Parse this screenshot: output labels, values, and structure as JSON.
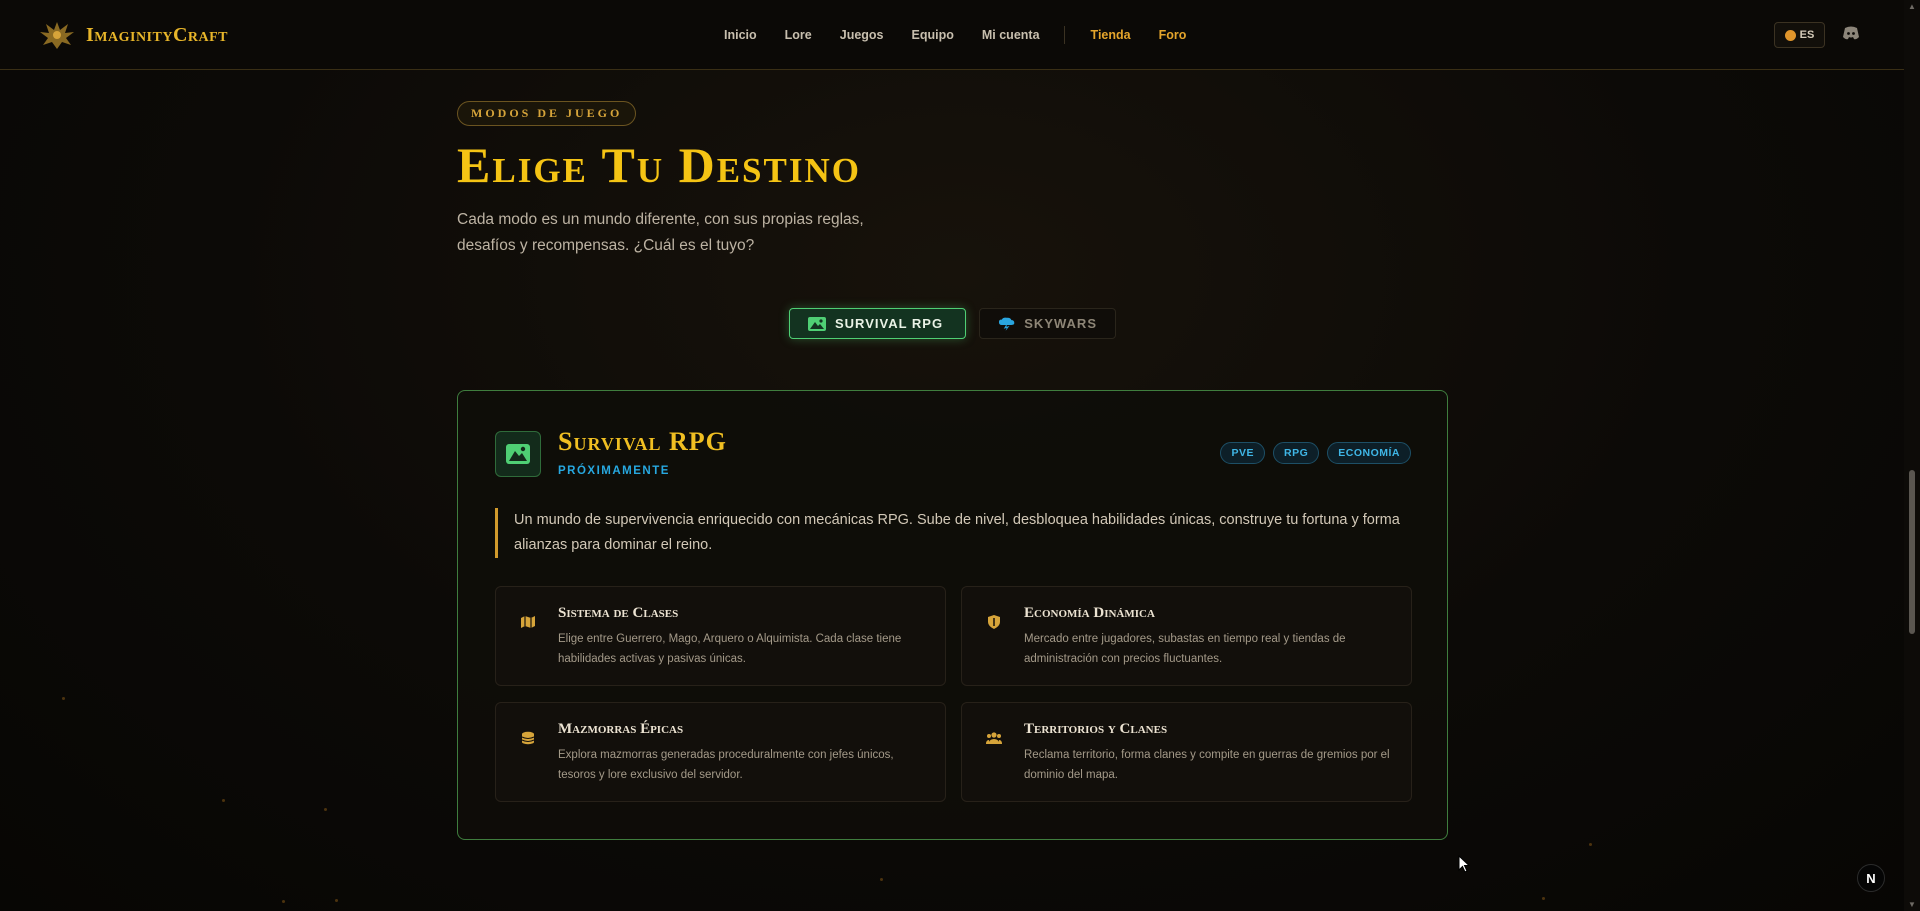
{
  "header": {
    "brand": "ImaginityCraft",
    "nav": [
      "Inicio",
      "Lore",
      "Juegos",
      "Equipo",
      "Mi cuenta"
    ],
    "nav_highlight": [
      "Tienda",
      "Foro"
    ],
    "language": "ES",
    "discord_icon": "discord-icon"
  },
  "section": {
    "eyebrow": "MODOS DE JUEGO",
    "title": "Elige Tu Destino",
    "subtitle": "Cada modo es un mundo diferente, con sus propias reglas, desafíos y recompensas. ¿Cuál es el tuyo?"
  },
  "tabs": [
    {
      "label": "SURVIVAL RPG",
      "icon": "mountain-icon",
      "active": true
    },
    {
      "label": "SKYWARS",
      "icon": "cloud-lightning-icon",
      "active": false
    }
  ],
  "card": {
    "title": "Survival RPG",
    "status": "PRÓXIMAMENTE",
    "tags": [
      "PVE",
      "RPG",
      "ECONOMÍA"
    ],
    "description": "Un mundo de supervivencia enriquecido con mecánicas RPG. Sube de nivel, desbloquea habilidades únicas, construye tu fortuna y forma alianzas para dominar el reino.",
    "features": [
      {
        "title": "Sistema de Clases",
        "desc": "Elige entre Guerrero, Mago, Arquero o Alquimista. Cada clase tiene habilidades activas y pasivas únicas.",
        "icon": "map-icon"
      },
      {
        "title": "Economía Dinámica",
        "desc": "Mercado entre jugadores, subastas en tiempo real y tiendas de administración con precios fluctuantes.",
        "icon": "shield-icon"
      },
      {
        "title": "Mazmorras Épicas",
        "desc": "Explora mazmorras generadas proceduralmente con jefes únicos, tesoros y lore exclusivo del servidor.",
        "icon": "coins-icon"
      },
      {
        "title": "Territorios y Clanes",
        "desc": "Reclama territorio, forma clanes y compite en guerras de gremios por el dominio del mapa.",
        "icon": "users-icon"
      }
    ]
  },
  "badge": "N",
  "colors": {
    "accent_gold": "#f5c414",
    "accent_green": "#4fcf74",
    "accent_blue": "#27a8e0"
  }
}
